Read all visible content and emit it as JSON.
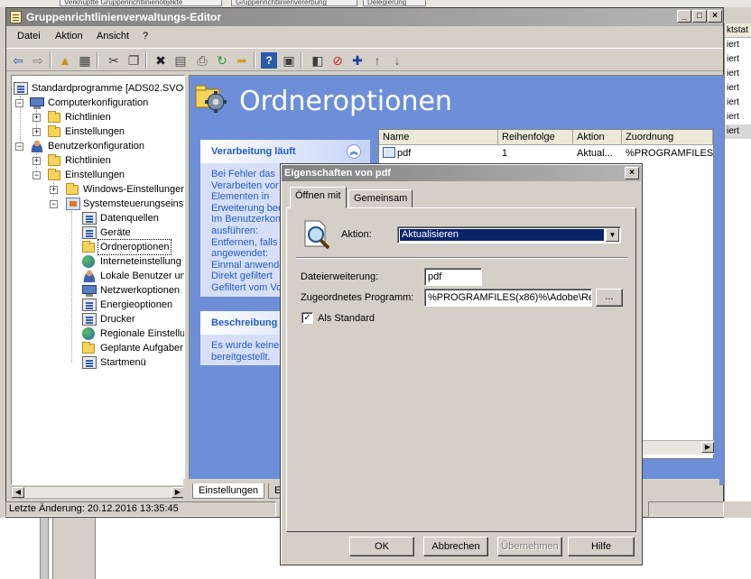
{
  "background": {
    "tabs": [
      "Verknüpfte Gruppenrichtlinienobjekte",
      "Gruppenrichtlinienvererbung",
      "Delegierung"
    ],
    "right_column_header": "ktstat",
    "right_column_rows": [
      "iert",
      "iert",
      "iert",
      "iert",
      "iert",
      "iert",
      "iert"
    ]
  },
  "window": {
    "title": "Gruppenrichtlinienverwaltungs-Editor",
    "controls": {
      "minimize": "_",
      "maximize": "□",
      "close": "×"
    }
  },
  "menu": [
    "Datei",
    "Aktion",
    "Ansicht",
    "?"
  ],
  "toolbar": {
    "icons": [
      "back-icon",
      "forward-icon",
      "up-folder-icon",
      "show-tree-icon",
      "cut-icon",
      "copy-icon",
      "delete-icon",
      "properties-icon",
      "print-icon",
      "refresh-icon",
      "export-icon",
      "help-icon",
      "view-icon",
      "new-item-icon",
      "stop-icon",
      "add-icon",
      "move-up-icon",
      "move-down-icon"
    ]
  },
  "tree": {
    "root": "Standardprogramme [ADS02.SVOG",
    "computer": "Computerkonfiguration",
    "computer_policies": "Richtlinien",
    "computer_settings": "Einstellungen",
    "user": "Benutzerkonfiguration",
    "user_policies": "Richtlinien",
    "user_settings": "Einstellungen",
    "windows_settings": "Windows-Einstellungen",
    "control_panel": "Systemsteuerungseinst",
    "items": [
      "Datenquellen",
      "Geräte",
      "Ordneroptionen",
      "Interneteinstellung",
      "Lokale Benutzer un",
      "Netzwerkoptionen",
      "Energieoptionen",
      "Drucker",
      "Regionale Einstellu",
      "Geplante Aufgaber",
      "Startmenü"
    ]
  },
  "content": {
    "title": "Ordneroptionen",
    "processing_panel": {
      "title": "Verarbeitung läuft",
      "lines": [
        "Bei Fehler das",
        "Verarbeiten vor",
        "Elementen in",
        "Erweiterung bee",
        "Im Benutzerkon",
        "ausführen:",
        "Entfernen, falls",
        "angewendet:",
        "Einmal anwende",
        "Direkt gefiltert",
        "Gefiltert vom Vo"
      ]
    },
    "description_panel": {
      "title": "Beschreibung",
      "lines": [
        "Es wurde keine",
        "bereitgestellt."
      ]
    },
    "list": {
      "columns": [
        "Name",
        "Reihenfolge",
        "Aktion",
        "Zuordnung"
      ],
      "rows": [
        {
          "name": "pdf",
          "order": "1",
          "action": "Aktual...",
          "assoc": "%PROGRAMFILES(x86)%"
        }
      ]
    },
    "tabs": [
      "Einstellungen",
      "E"
    ]
  },
  "statusbar": {
    "text": "Letzte Änderung: 20.12.2016 13:35:45"
  },
  "dialog": {
    "title": "Eigenschaften von pdf",
    "close": "×",
    "tabs": [
      "Öffnen mit",
      "Gemeinsam"
    ],
    "action_label": "Aktion:",
    "action_value": "Aktualisieren",
    "ext_label": "Dateierweiterung:",
    "ext_value": "pdf",
    "program_label": "Zugeordnetes Programm:",
    "program_value": "%PROGRAMFILES(x86)%\\Adobe\\Re",
    "browse_label": "...",
    "default_label": "Als Standard",
    "default_checked": true,
    "buttons": {
      "ok": "OK",
      "cancel": "Abbrechen",
      "apply": "Übernehmen",
      "help": "Hilfe"
    }
  }
}
